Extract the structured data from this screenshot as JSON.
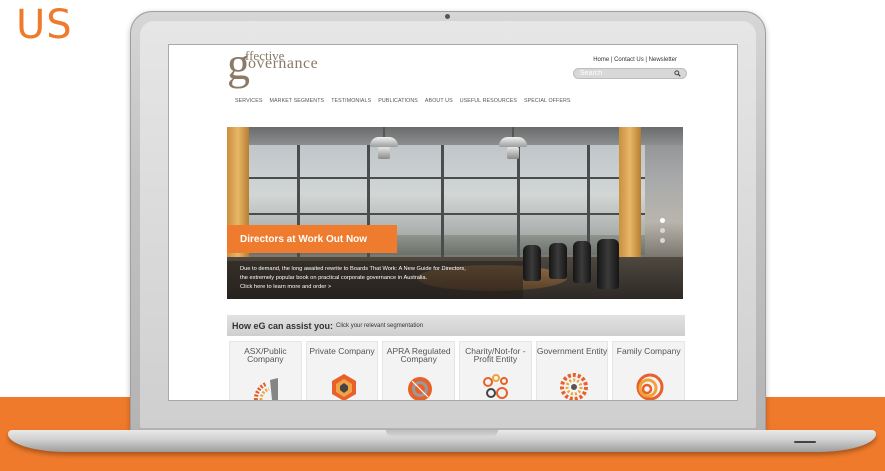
{
  "corner_text": "US",
  "site": {
    "logo": {
      "top": "ffective",
      "bottom": "overnance",
      "g_letter": "g"
    },
    "top_links": "Home | Contact Us | Newsletter",
    "search": {
      "placeholder": "Search"
    },
    "nav": [
      "SERVICES",
      "MARKET SEGMENTS",
      "TESTIMONIALS",
      "PUBLICATIONS",
      "ABOUT US",
      "USEFUL RESOURCES",
      "SPECIAL OFFERS"
    ],
    "hero": {
      "banner": "Directors at Work Out Now",
      "lines": [
        "Due to demand, the long awaited rewrite to Boards That Work: A New Guide for Directors,",
        "the extremely popular book on practical corporate governance in Australia.",
        "Click here to learn more and order >"
      ],
      "slides": 3,
      "active_slide": 1
    },
    "assist": {
      "title": "How eG can assist you:",
      "subtitle": "Click your relevant segmentation"
    },
    "segments": [
      {
        "label": "ASX/Public Company",
        "icon": "asx-public-segment-icon"
      },
      {
        "label": "Private Company",
        "icon": "private-company-segment-icon"
      },
      {
        "label": "APRA Regulated Company",
        "icon": "apra-regulated-segment-icon"
      },
      {
        "label": "Charity/Not-for -Profit Entity",
        "icon": "charity-segment-icon"
      },
      {
        "label": "Government Entity",
        "icon": "government-segment-icon"
      },
      {
        "label": "Family Company",
        "icon": "family-company-segment-icon"
      }
    ]
  },
  "colors": {
    "accent": "#f07a2b",
    "logo": "#8a7a66",
    "banner": "#ee7b2e"
  }
}
